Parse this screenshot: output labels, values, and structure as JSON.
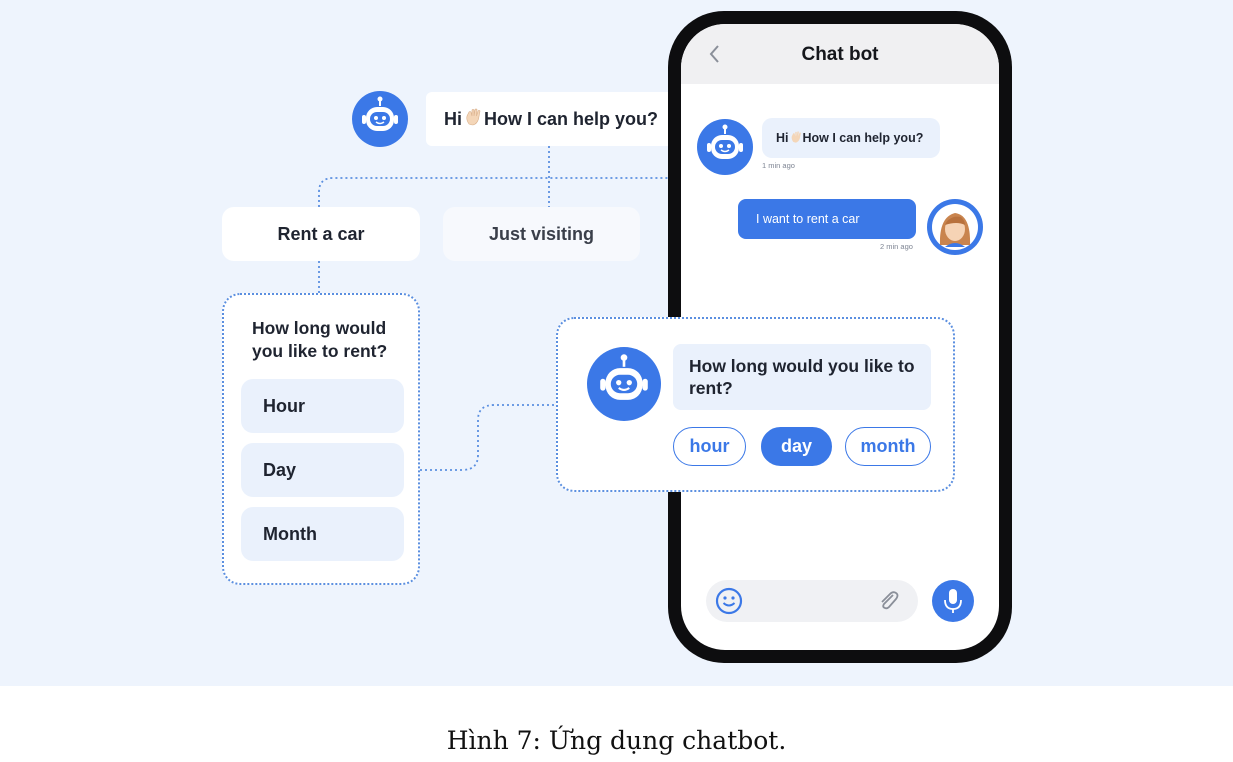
{
  "flow": {
    "greeting": "Hi",
    "greeting_rest": "How I can help you?",
    "choices": [
      "Rent a car",
      "Just visiting"
    ],
    "question": "How long would you like to rent?",
    "options": [
      "Hour",
      "Day",
      "Month"
    ]
  },
  "phone": {
    "title": "Chat bot",
    "bot_message": "Hi",
    "bot_message_rest": "How I can help you?",
    "bot_time": "1 min ago",
    "user_message": "I want to rent a car",
    "user_time": "2 min ago"
  },
  "popup": {
    "question": "How long would you like to rent?",
    "pills": [
      "hour",
      "day",
      "month"
    ],
    "selected": "day"
  },
  "caption": "Hình 7: Ứng dụng chatbot.",
  "colors": {
    "accent": "#3b78e7",
    "panel_bg": "#eef4fd",
    "option_bg": "#eaf1fc"
  },
  "icons": [
    "robot-icon",
    "waving-hand-icon",
    "back-arrow-icon",
    "emoji-icon",
    "paperclip-icon",
    "microphone-icon",
    "user-avatar"
  ]
}
